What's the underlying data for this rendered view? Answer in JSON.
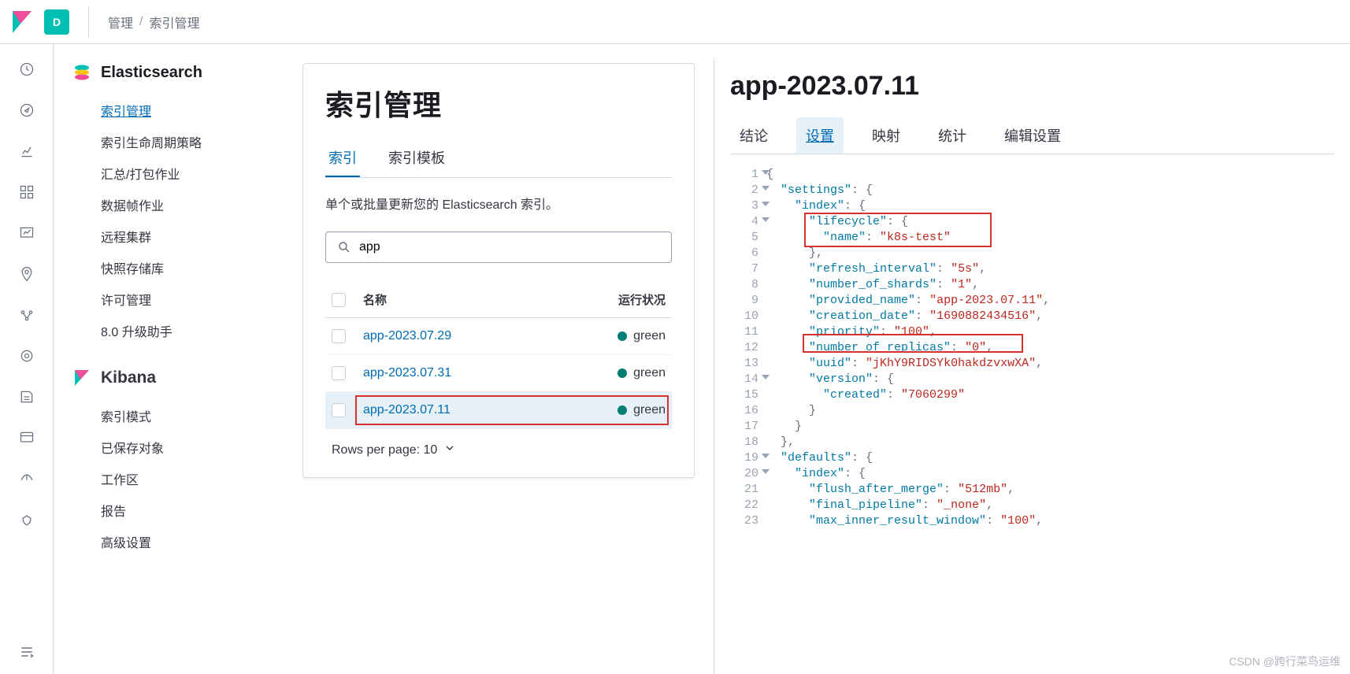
{
  "header": {
    "badge": "D",
    "breadcrumb": [
      "管理",
      "索引管理"
    ]
  },
  "sidebar": {
    "elasticsearch": {
      "title": "Elasticsearch",
      "items": [
        "索引管理",
        "索引生命周期策略",
        "汇总/打包作业",
        "数据帧作业",
        "远程集群",
        "快照存储库",
        "许可管理",
        "8.0 升级助手"
      ],
      "activeIndex": 0
    },
    "kibana": {
      "title": "Kibana",
      "items": [
        "索引模式",
        "已保存对象",
        "工作区",
        "报告",
        "高级设置"
      ]
    }
  },
  "main": {
    "title": "索引管理",
    "tabs": [
      "索引",
      "索引模板"
    ],
    "activeTab": 0,
    "description": "单个或批量更新您的 Elasticsearch 索引。",
    "searchValue": "app",
    "columns": {
      "name": "名称",
      "status": "运行状况"
    },
    "rows": [
      {
        "name": "app-2023.07.29",
        "status": "green",
        "selected": false
      },
      {
        "name": "app-2023.07.31",
        "status": "green",
        "selected": false
      },
      {
        "name": "app-2023.07.11",
        "status": "green",
        "selected": true
      }
    ],
    "pager": {
      "label": "Rows per page: 10"
    }
  },
  "detail": {
    "title": "app-2023.07.11",
    "tabs": [
      "结论",
      "设置",
      "映射",
      "统计",
      "编辑设置"
    ],
    "activeTab": 1,
    "settings_json": {
      "settings": {
        "index": {
          "lifecycle": {
            "name": "k8s-test"
          },
          "refresh_interval": "5s",
          "number_of_shards": "1",
          "provided_name": "app-2023.07.11",
          "creation_date": "1690882434516",
          "priority": "100",
          "number_of_replicas": "0",
          "uuid": "jKhY9RIDSYk0hakdzvxwXA",
          "version": {
            "created": "7060299"
          }
        }
      },
      "defaults": {
        "index": {
          "flush_after_merge": "512mb",
          "final_pipeline": "_none",
          "max_inner_result_window": "100"
        }
      }
    }
  },
  "watermark": "CSDN @跨行菜鸟运维"
}
